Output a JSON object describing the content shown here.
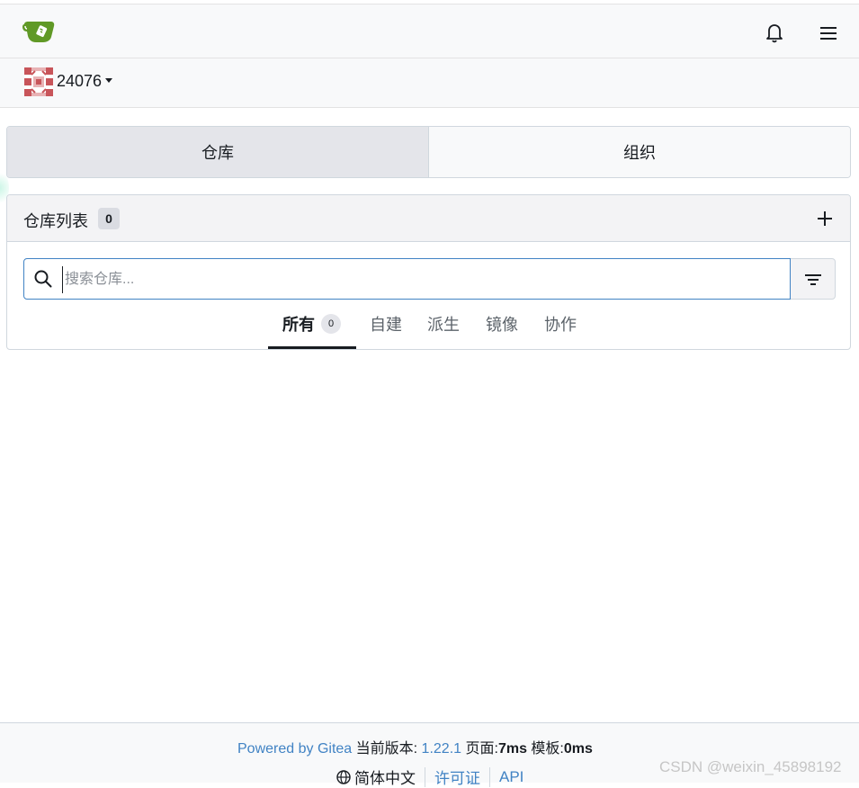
{
  "header": {
    "logo_icon": "gitea-teacup-icon",
    "notifications_icon": "bell-icon",
    "menu_icon": "hamburger-menu-icon"
  },
  "context": {
    "avatar_icon": "identicon-avatar",
    "username": "24076",
    "dropdown_icon": "caret-down-icon"
  },
  "switcher": {
    "items": [
      {
        "label": "仓库",
        "active": true
      },
      {
        "label": "组织",
        "active": false
      }
    ]
  },
  "repo_panel": {
    "title": "仓库列表",
    "count": "0",
    "add_icon": "plus-icon",
    "search": {
      "placeholder": "搜索仓库...",
      "value": "",
      "icon": "search-icon",
      "filter_icon": "filter-icon"
    },
    "tabs": [
      {
        "label": "所有",
        "count": "0",
        "active": true
      },
      {
        "label": "自建"
      },
      {
        "label": "派生"
      },
      {
        "label": "镜像"
      },
      {
        "label": "协作"
      }
    ]
  },
  "footer": {
    "powered_by": "Powered by Gitea",
    "version_label": "当前版本:",
    "version": "1.22.1",
    "page_label": "页面:",
    "page_time": "7ms",
    "template_label": "模板:",
    "template_time": "0ms",
    "language": "简体中文",
    "license": "许可证",
    "api": "API"
  },
  "watermark": "CSDN @weixin_45898192",
  "colors": {
    "accent": "#4183c4",
    "gitea_green": "#609926",
    "avatar_red": "#c8555a"
  }
}
